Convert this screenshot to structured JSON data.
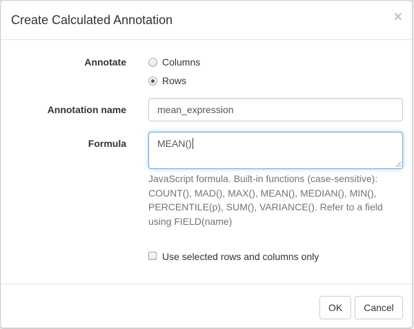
{
  "dialog": {
    "title": "Create Calculated Annotation",
    "close_glyph": "×"
  },
  "annotate": {
    "label": "Annotate",
    "options": [
      {
        "label": "Columns",
        "checked": false
      },
      {
        "label": "Rows",
        "checked": true
      }
    ]
  },
  "annotation_name": {
    "label": "Annotation name",
    "value": "mean_expression"
  },
  "formula": {
    "label": "Formula",
    "value": "MEAN()",
    "help_text": "JavaScript formula. Built-in functions (case-sensitive): COUNT(), MAD(), MAX(), MEAN(), MEDIAN(), MIN(), PERCENTILE(p), SUM(), VARIANCE(). Refer to a field using FIELD(name)"
  },
  "selection_only": {
    "label": "Use selected rows and columns only",
    "checked": false
  },
  "footer": {
    "ok_label": "OK",
    "cancel_label": "Cancel"
  },
  "icons": {
    "close": "close-icon",
    "radio_unchecked": "radio-unchecked-icon",
    "radio_checked": "radio-checked-icon",
    "checkbox": "checkbox-unchecked-icon"
  },
  "colors": {
    "focus_border": "#66afe9",
    "help_text": "#737373"
  }
}
